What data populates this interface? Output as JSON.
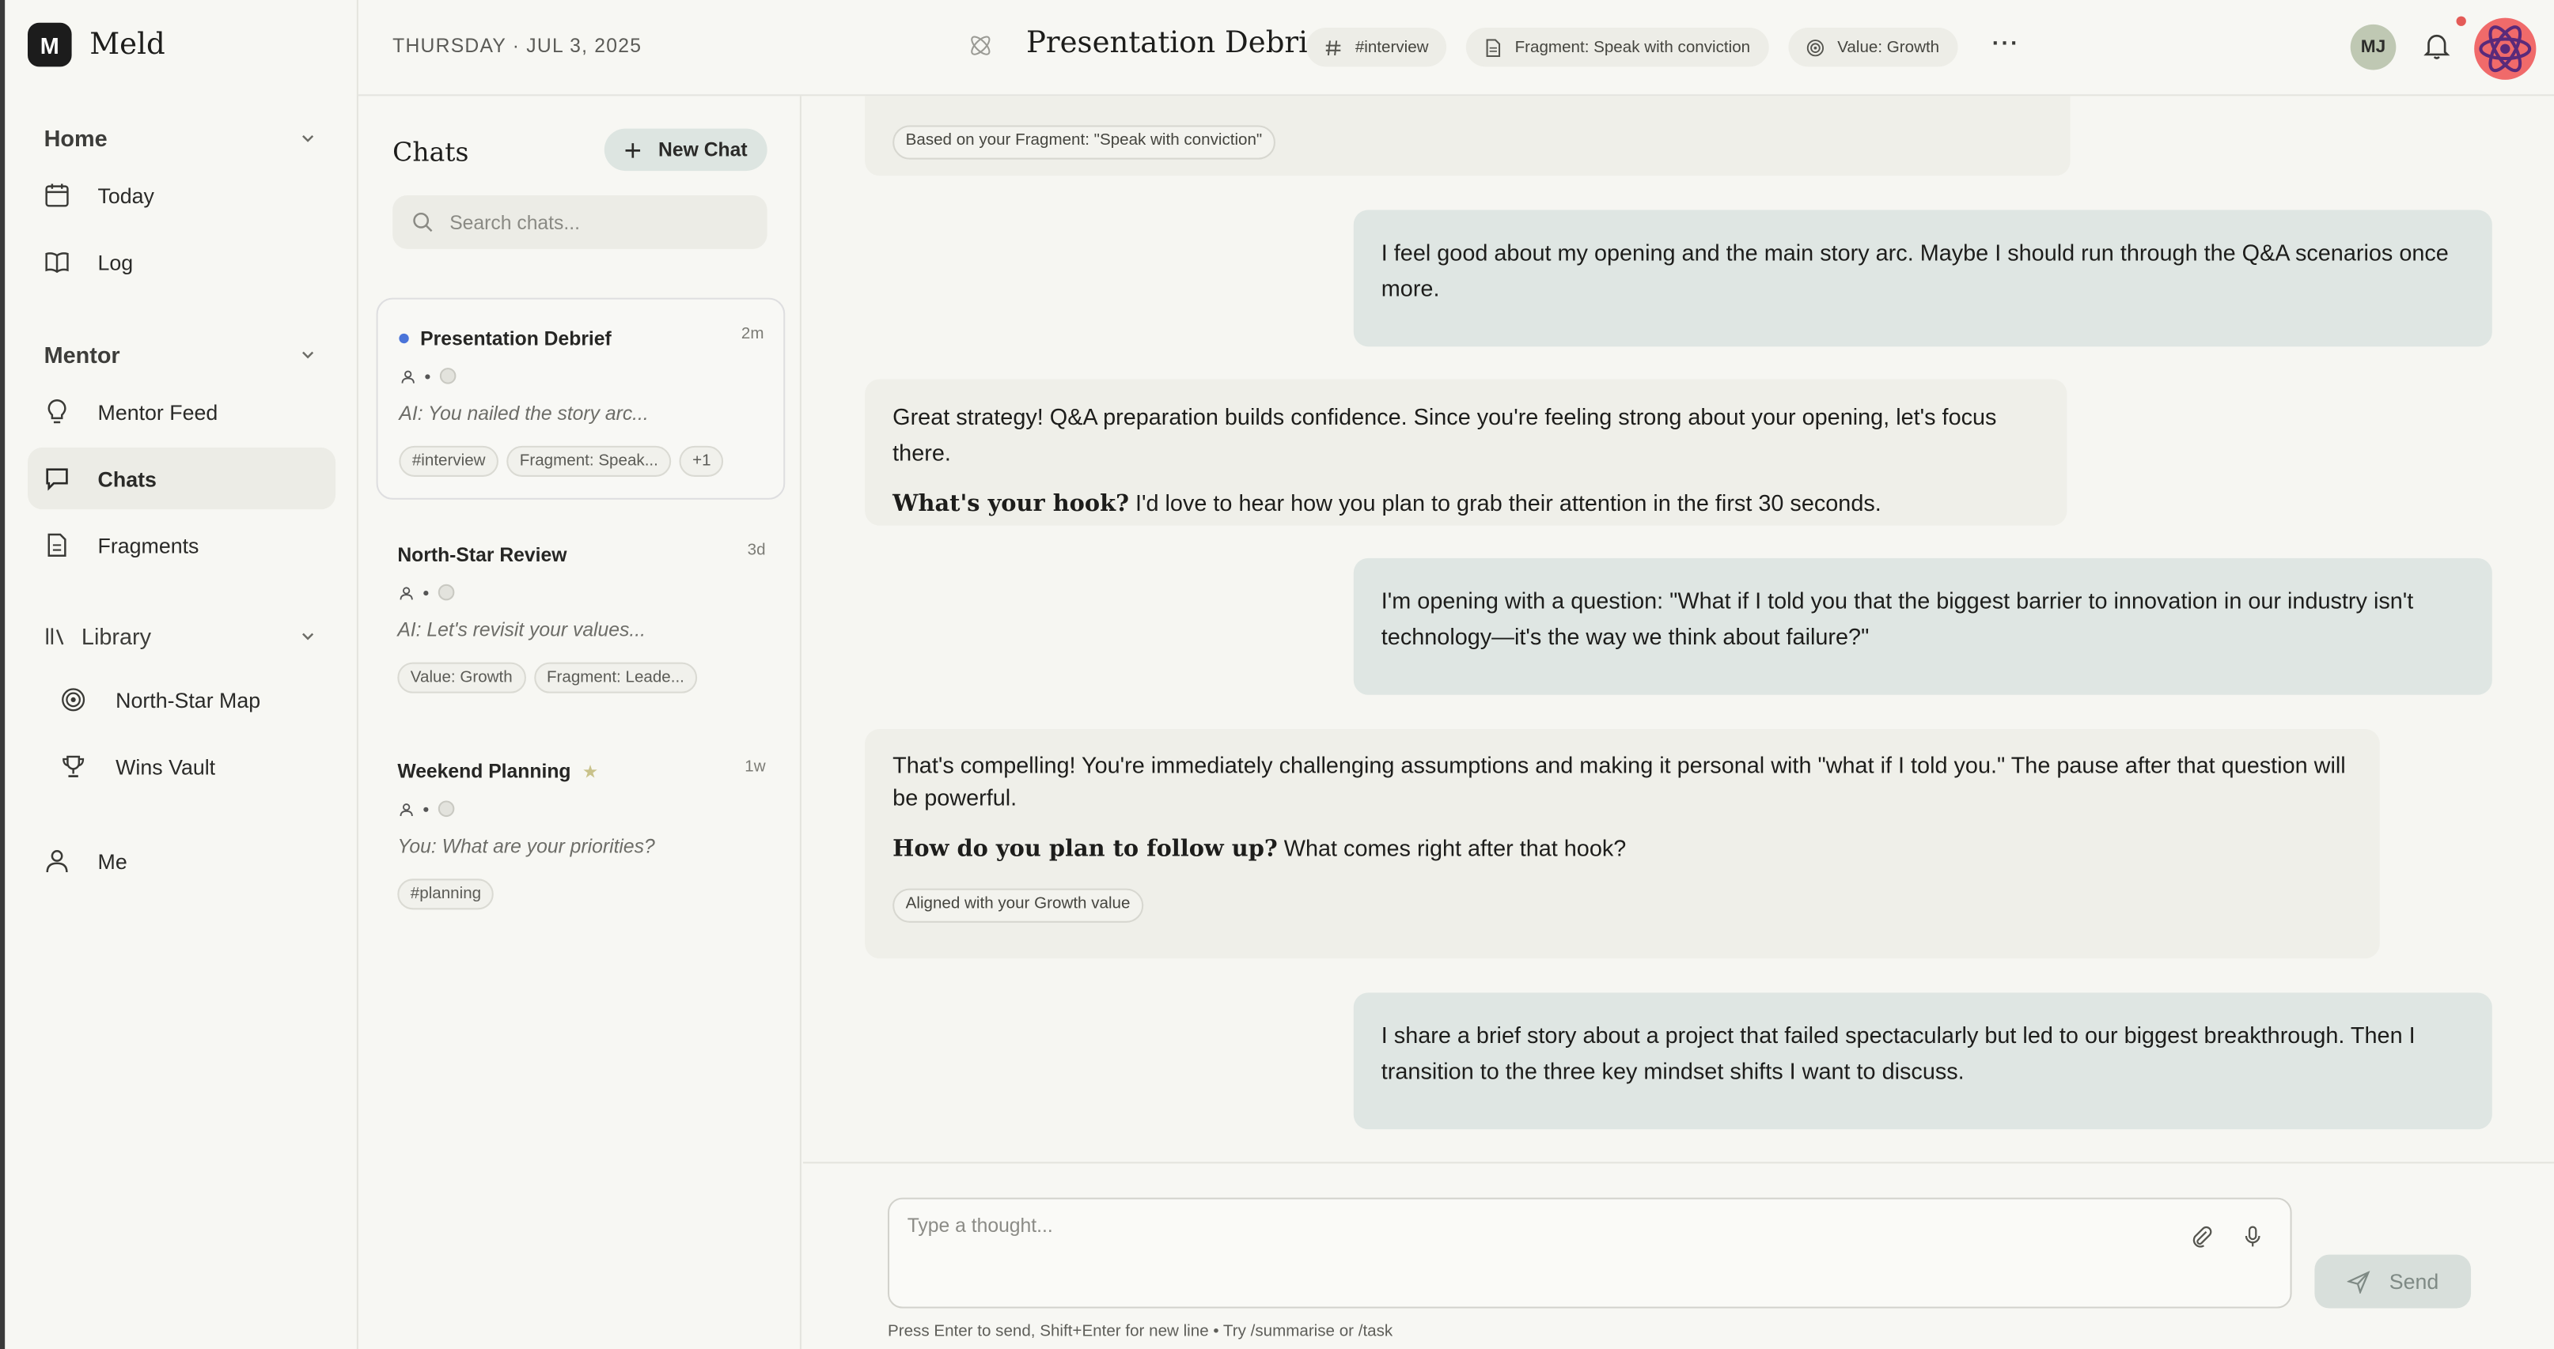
{
  "app": {
    "name": "Meld",
    "logo_letter": "M"
  },
  "sidebar": {
    "sections": [
      {
        "label": "Home"
      },
      {
        "label": "Mentor"
      },
      {
        "label": "Library"
      }
    ],
    "home_items": [
      {
        "label": "Today",
        "icon": "calendar-icon"
      },
      {
        "label": "Log",
        "icon": "book-icon"
      }
    ],
    "mentor_items": [
      {
        "label": "Mentor Feed",
        "icon": "lightbulb-icon"
      },
      {
        "label": "Chats",
        "icon": "chat-bubble-icon",
        "active": true
      },
      {
        "label": "Fragments",
        "icon": "document-icon"
      }
    ],
    "library_items": [
      {
        "label": "North-Star Map",
        "icon": "target-icon"
      },
      {
        "label": "Wins Vault",
        "icon": "trophy-icon"
      }
    ],
    "me": {
      "label": "Me",
      "icon": "person-icon"
    }
  },
  "topbar": {
    "date": "THURSDAY · JUL 3, 2025",
    "title": "Presentation Debrief",
    "chips": [
      {
        "label": "#interview",
        "icon": "hash-icon"
      },
      {
        "label": "Fragment: Speak with conviction",
        "icon": "document-icon"
      },
      {
        "label": "Value: Growth",
        "icon": "target-icon"
      }
    ],
    "more": "···",
    "avatar_initials": "MJ"
  },
  "chats_panel": {
    "title": "Chats",
    "new_chat_label": "New Chat",
    "search_placeholder": "Search chats...",
    "items": [
      {
        "name": "Presentation Debrief",
        "ago": "2m",
        "preview": "AI: You nailed the story arc...",
        "tags": [
          "#interview",
          "Fragment: Speak...",
          "+1"
        ],
        "unread": true
      },
      {
        "name": "North-Star Review",
        "ago": "3d",
        "preview": "AI: Let's revisit your values...",
        "tags": [
          "Value: Growth",
          "Fragment: Leade..."
        ]
      },
      {
        "name": "Weekend Planning",
        "ago": "1w",
        "preview": "You: What are your priorities?",
        "tags": [
          "#planning"
        ],
        "starred": true
      }
    ]
  },
  "conversation": {
    "messages": [
      {
        "role": "ai",
        "tag": "Based on your Fragment: \"Speak with conviction\""
      },
      {
        "role": "user",
        "text": "I feel good about my opening and the main story arc. Maybe I should run through the Q&A scenarios once more."
      },
      {
        "role": "ai",
        "text": "Great strategy! Q&A preparation builds confidence. Since you're feeling strong about your opening, let's focus there.",
        "question": "What's your hook?",
        "followup": "I'd love to hear how you plan to grab their attention in the first 30 seconds."
      },
      {
        "role": "user",
        "text": "I'm opening with a question: \"What if I told you that the biggest barrier to innovation in our industry isn't technology—it's the way we think about failure?\""
      },
      {
        "role": "ai",
        "text": "That's compelling! You're immediately challenging assumptions and making it personal with \"what if I told you.\" The pause after that question will be powerful.",
        "question": "How do you plan to follow up?",
        "followup": "What comes right after that hook?",
        "tag": "Aligned with your Growth value"
      },
      {
        "role": "user",
        "text": "I share a brief story about a project that failed spectacularly but led to our biggest breakthrough. Then I transition to the three key mindset shifts I want to discuss."
      }
    ]
  },
  "composer": {
    "placeholder": "Type a thought...",
    "send_label": "Send",
    "hint": "Press Enter to send, Shift+Enter for new line • Try /summarise or /task"
  }
}
